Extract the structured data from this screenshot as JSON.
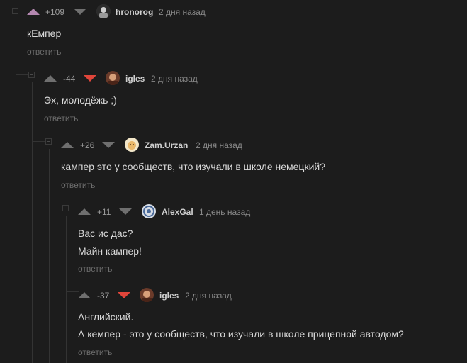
{
  "comments": [
    {
      "score": "+109",
      "username": "hronorog",
      "time": "2 дня назад",
      "lines": [
        "кЕмпер"
      ],
      "reply": "ответить",
      "vote_state": "up",
      "colors": {
        "up": "#b487b0",
        "down": "#6f6f6f"
      }
    },
    {
      "score": "-44",
      "username": "igles",
      "time": "2 дня назад",
      "lines": [
        "Эх, молодёжь ;)"
      ],
      "reply": "ответить",
      "vote_state": "down",
      "colors": {
        "up": "#6f6f6f",
        "down": "#e0453a"
      }
    },
    {
      "score": "+26",
      "username": "Zam.Urzan",
      "time": "2 дня назад",
      "lines": [
        "кампер это у сообществ, что изучали в школе немецкий?"
      ],
      "reply": "ответить",
      "vote_state": "none",
      "colors": {
        "up": "#6f6f6f",
        "down": "#6f6f6f"
      }
    },
    {
      "score": "+11",
      "username": "AlexGal",
      "time": "1 день назад",
      "lines": [
        "Вас ис дас?",
        "Майн кампер!"
      ],
      "reply": "ответить",
      "vote_state": "none",
      "colors": {
        "up": "#6f6f6f",
        "down": "#6f6f6f"
      }
    },
    {
      "score": "-37",
      "username": "igles",
      "time": "2 дня назад",
      "lines": [
        "Английский.",
        "А кемпер - это у сообществ, что изучали в школе прицепной автодом?"
      ],
      "reply": "ответить",
      "vote_state": "down",
      "colors": {
        "up": "#6f6f6f",
        "down": "#e0453a"
      }
    }
  ]
}
